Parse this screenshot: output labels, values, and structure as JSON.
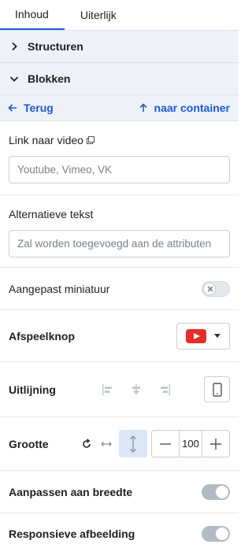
{
  "tabs": [
    {
      "label": "Inhoud",
      "active": true
    },
    {
      "label": "Uiterlijk",
      "active": false
    }
  ],
  "accordions": {
    "structuren": "Structuren",
    "blokken": "Blokken"
  },
  "nav": {
    "back": "Terug",
    "container": "naar container"
  },
  "video_link": {
    "label": "Link naar video",
    "placeholder": "Youtube, Vimeo, VK"
  },
  "alt_text": {
    "label": "Alternatieve tekst",
    "placeholder": "Zal worden toegevoegd aan de attributen"
  },
  "custom_thumbnail": {
    "label": "Aangepast miniatuur",
    "enabled": false
  },
  "play_button": {
    "label": "Afspeelknop",
    "selected": "youtube-icon"
  },
  "alignment": {
    "label": "Uitlijning"
  },
  "size": {
    "label": "Grootte",
    "value": "100"
  },
  "fit_width": {
    "label": "Aanpassen aan breedte",
    "enabled": true
  },
  "responsive_image": {
    "label": "Responsieve afbeelding",
    "enabled": true
  },
  "colors": {
    "accent": "#1e58d6",
    "panel_bg": "#eef2f8",
    "active_bg": "#dbe6f7",
    "youtube_red": "#e52d27"
  }
}
